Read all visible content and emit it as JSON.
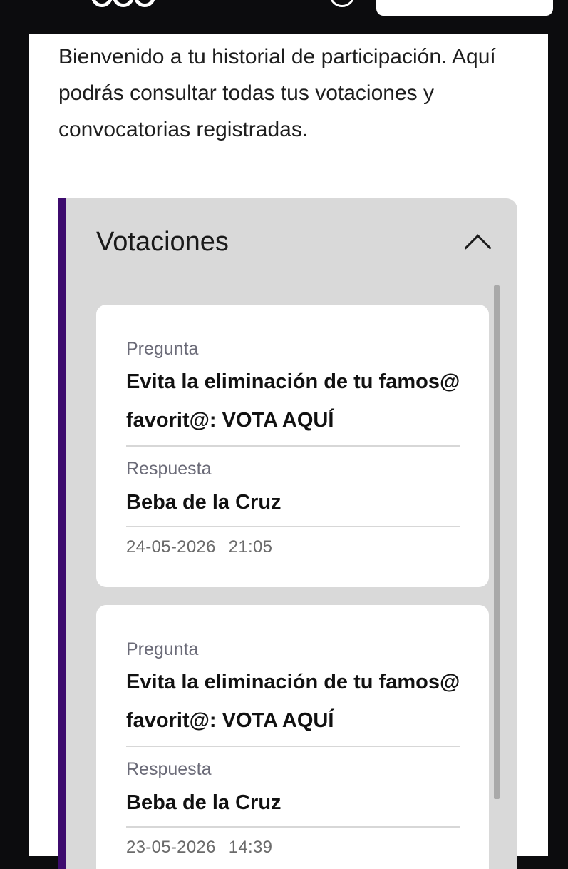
{
  "intro_text": "Bienvenido a tu historial de participación. Aquí podrás consultar todas tus votaciones y convocatorias registradas.",
  "accordion": {
    "title": "Votaciones",
    "icon": "chevron-up-icon"
  },
  "votes": [
    {
      "question_label": "Pregunta",
      "question": "Evita la eliminación de tu famos@ favorit@: VOTA AQUÍ",
      "answer_label": "Respuesta",
      "answer": "Beba de la Cruz",
      "date": "24-05-2026",
      "time": "21:05"
    },
    {
      "question_label": "Pregunta",
      "question": "Evita la eliminación de tu famos@ favorit@: VOTA AQUÍ",
      "answer_label": "Respuesta",
      "answer": "Beba de la Cruz",
      "date": "23-05-2026",
      "time": "14:39"
    }
  ],
  "colors": {
    "background": "#0c0c0e",
    "accent_bar": "#3d0b6e",
    "accordion_bg": "#d9d9d9",
    "card_bg": "#ffffff",
    "muted_label": "#6b6b78"
  }
}
